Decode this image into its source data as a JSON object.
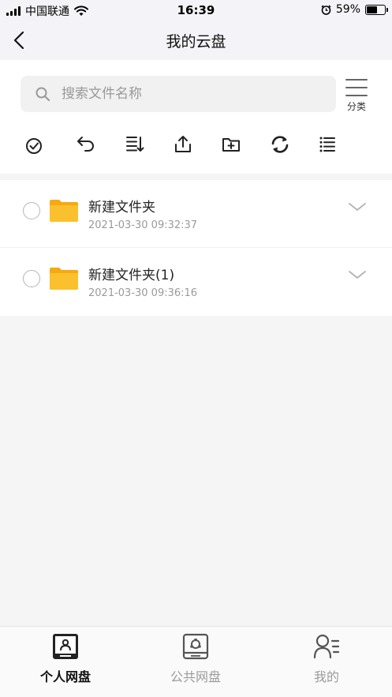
{
  "status_bar": {
    "carrier": "中国联通",
    "time": "16:39",
    "battery": "59%",
    "battery_level": 0.59
  },
  "nav": {
    "title": "我的云盘"
  },
  "search": {
    "placeholder": "搜索文件名称"
  },
  "category": {
    "label": "分类"
  },
  "toolbar": {
    "icons": [
      "select-all-icon",
      "undo-icon",
      "sort-icon",
      "upload-icon",
      "new-folder-icon",
      "refresh-icon",
      "list-view-icon"
    ]
  },
  "files": [
    {
      "name": "新建文件夹",
      "time": "2021-03-30 09:32:37"
    },
    {
      "name": "新建文件夹(1)",
      "time": "2021-03-30 09:36:16"
    }
  ],
  "colors": {
    "folder": "#f9b920",
    "accent": "#111111",
    "inactive": "#9b9b9b"
  },
  "tabs": [
    {
      "label": "个人网盘",
      "active": true
    },
    {
      "label": "公共网盘",
      "active": false
    },
    {
      "label": "我的",
      "active": false
    }
  ]
}
